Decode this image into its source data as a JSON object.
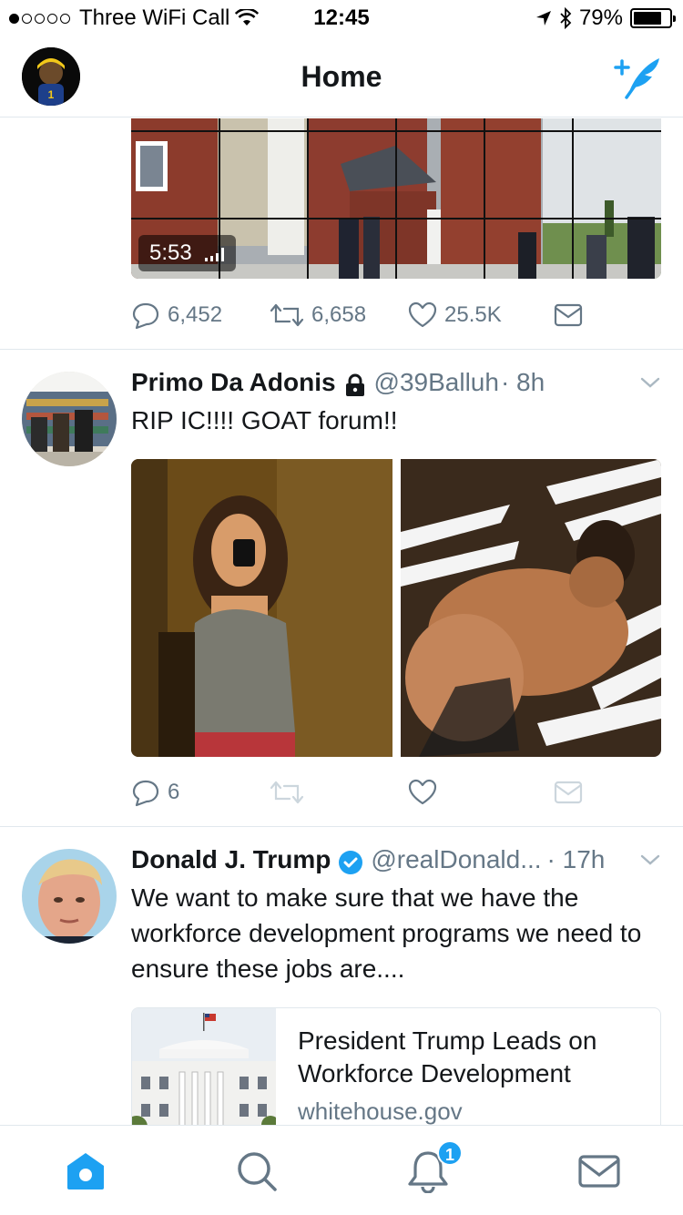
{
  "status_bar": {
    "carrier": "Three WiFi Call",
    "time": "12:45",
    "battery": "79%",
    "battery_level": 0.79,
    "signal_bars": 1
  },
  "nav": {
    "title": "Home",
    "accent": "#1da1f2"
  },
  "tweets": [
    {
      "video_duration": "5:53",
      "replies": "6,452",
      "retweets": "6,658",
      "likes": "25.5K"
    },
    {
      "name": "Primo Da Adonis",
      "protected": true,
      "handle": "@39Balluh",
      "time": "· 8h",
      "text": "RIP IC!!!!  GOAT forum!!",
      "replies": "6"
    },
    {
      "name": "Donald J. Trump",
      "verified": true,
      "handle": "@realDonald...",
      "time": "· 17h",
      "text": "We want to make sure that we have the workforce development programs we need to ensure these jobs are....",
      "card": {
        "title": "President Trump Leads on Workforce Development",
        "domain": "whitehouse.gov"
      }
    }
  ],
  "tab_bar": {
    "notifications_badge": "1",
    "items": [
      "home-icon",
      "search-icon",
      "bell-icon",
      "mail-icon"
    ]
  }
}
